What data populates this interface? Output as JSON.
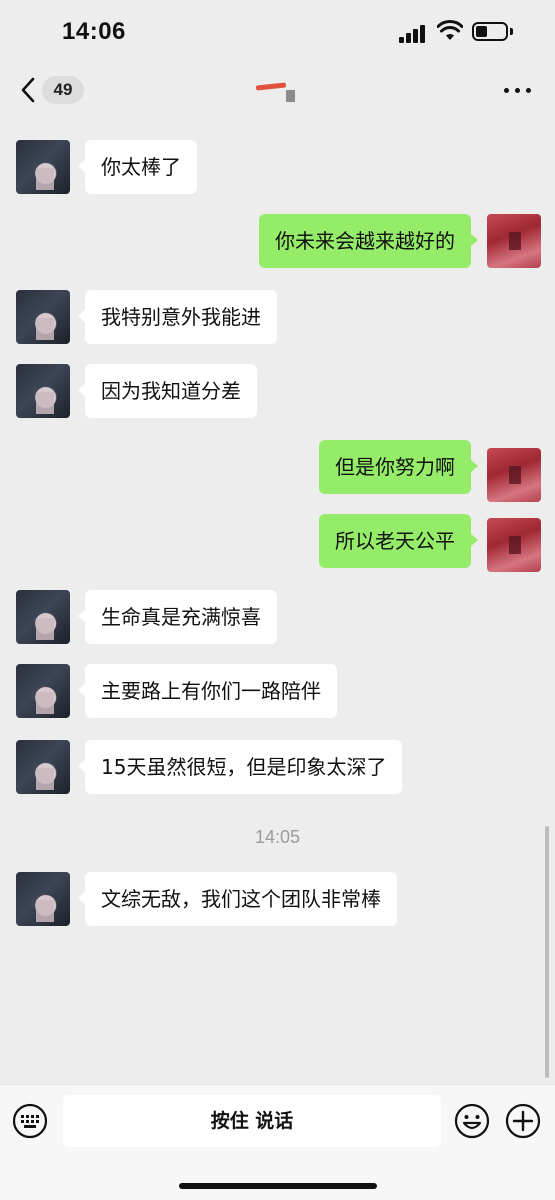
{
  "status_bar": {
    "time": "14:06"
  },
  "nav": {
    "unread_count": "49"
  },
  "messages": [
    {
      "side": "them",
      "text": "你太棒了"
    },
    {
      "side": "me",
      "text": "你未来会越来越好的"
    },
    {
      "side": "them",
      "text": "我特别意外我能进"
    },
    {
      "side": "them",
      "text": "因为我知道分差"
    },
    {
      "side": "me",
      "text": "但是你努力啊"
    },
    {
      "side": "me",
      "text": "所以老天公平"
    },
    {
      "side": "them",
      "text": "生命真是充满惊喜"
    },
    {
      "side": "them",
      "text": "主要路上有你们一路陪伴"
    },
    {
      "side": "them",
      "text": "15天虽然很短，但是印象太深了"
    },
    {
      "side": "them",
      "text": "文综无敌，我们这个团队非常棒"
    }
  ],
  "timestamp_divider": "14:05",
  "input_bar": {
    "hold_to_talk_label": "按住 说话"
  },
  "colors": {
    "background": "#ededed",
    "my_bubble": "#95ec69",
    "their_bubble": "#ffffff",
    "timestamp": "#9b9b9b"
  },
  "icons": {
    "back": "chevron-left-icon",
    "more": "ellipsis-icon",
    "keyboard": "keyboard-icon",
    "emoji": "smiley-icon",
    "plus": "plus-icon"
  }
}
